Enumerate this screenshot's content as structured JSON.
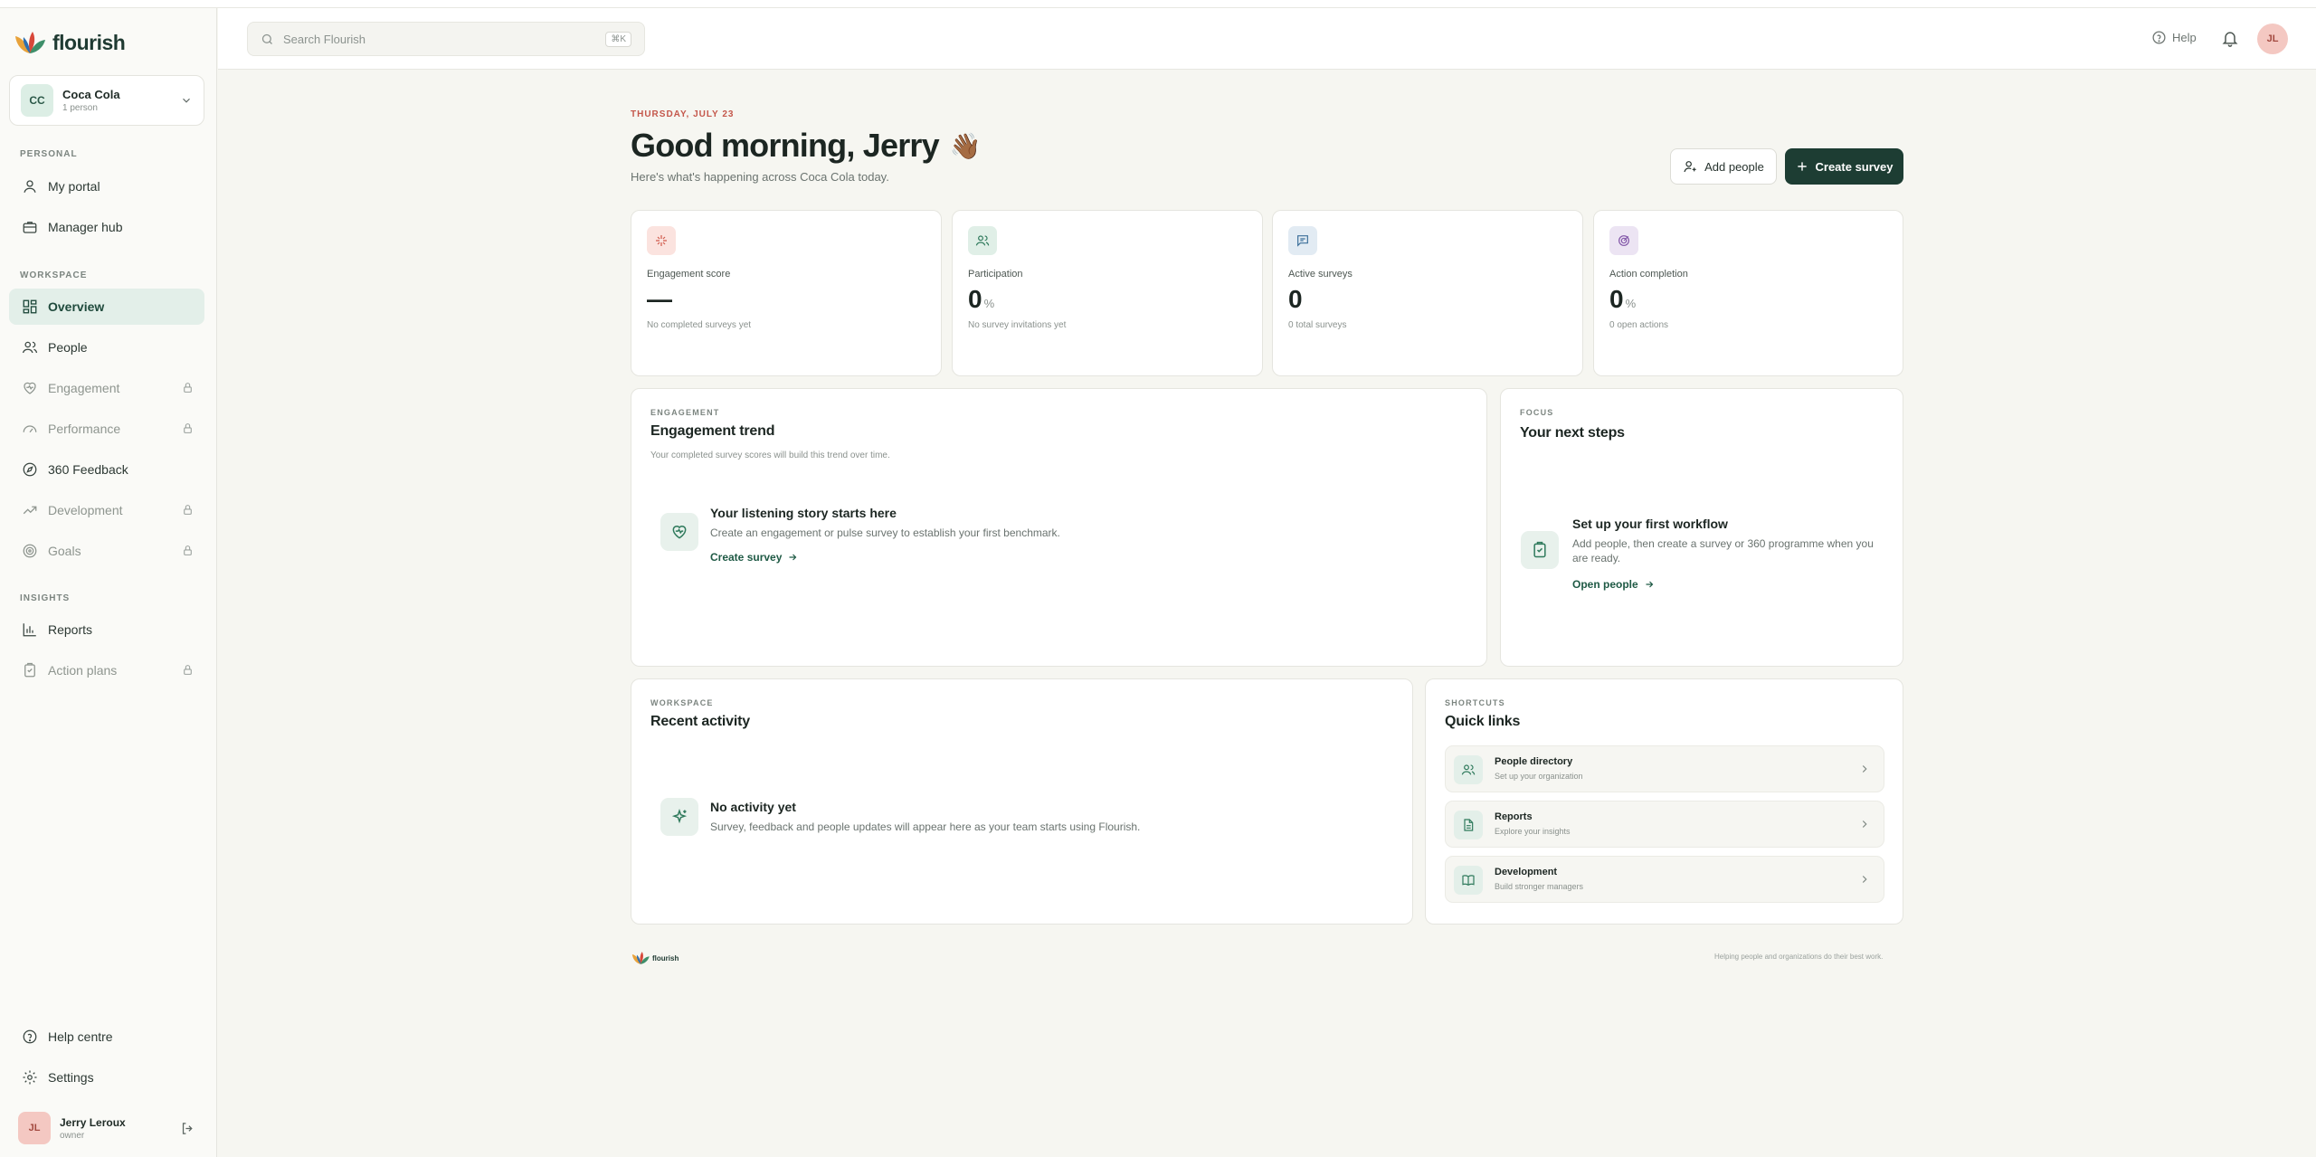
{
  "app": {
    "name": "flourish"
  },
  "org": {
    "initials": "CC",
    "name": "Coca Cola",
    "members": "1 person"
  },
  "sidebar": {
    "personal_label": "PERSONAL",
    "workspace_label": "WORKSPACE",
    "insights_label": "INSIGHTS",
    "personal": [
      {
        "label": "My portal",
        "icon": "user-icon"
      },
      {
        "label": "Manager hub",
        "icon": "briefcase-icon"
      }
    ],
    "workspace": [
      {
        "label": "Overview",
        "icon": "grid-icon",
        "active": true
      },
      {
        "label": "People",
        "icon": "users-icon"
      },
      {
        "label": "Engagement",
        "icon": "heart-icon",
        "locked": true
      },
      {
        "label": "Performance",
        "icon": "gauge-icon",
        "locked": true
      },
      {
        "label": "360 Feedback",
        "icon": "compass-icon"
      },
      {
        "label": "Development",
        "icon": "trend-icon",
        "locked": true
      },
      {
        "label": "Goals",
        "icon": "target-icon",
        "locked": true
      }
    ],
    "insights": [
      {
        "label": "Reports",
        "icon": "bar-chart-icon"
      },
      {
        "label": "Action plans",
        "icon": "clipboard-icon",
        "locked": true
      }
    ],
    "footer": [
      {
        "label": "Help centre",
        "icon": "help-icon"
      },
      {
        "label": "Settings",
        "icon": "gear-icon"
      }
    ]
  },
  "user": {
    "initials": "JL",
    "name": "Jerry Leroux",
    "role": "owner"
  },
  "topbar": {
    "search_placeholder": "Search Flourish",
    "shortcut": "⌘K",
    "help_label": "Help",
    "avatar_initials": "JL"
  },
  "header": {
    "date": "THURSDAY, JULY 23",
    "greeting": "Good morning, Jerry",
    "greeting_emoji": "👋🏾",
    "subtitle": "Here's what's happening across Coca Cola today.",
    "add_people": "Add people",
    "create_survey": "Create survey"
  },
  "stats": [
    {
      "label": "Engagement score",
      "value": "—",
      "unit": "",
      "note": "No completed surveys yet",
      "icon": "sparkle-icon",
      "color": "#fbe3df"
    },
    {
      "label": "Participation",
      "value": "0",
      "unit": "%",
      "note": "No survey invitations yet",
      "icon": "users-icon",
      "color": "#e0efe7"
    },
    {
      "label": "Active surveys",
      "value": "0",
      "unit": "",
      "note": "0 total surveys",
      "icon": "message-icon",
      "color": "#e2ebf3"
    },
    {
      "label": "Action completion",
      "value": "0",
      "unit": "%",
      "note": "0 open actions",
      "icon": "target-icon",
      "color": "#ece4f3"
    }
  ],
  "engagement": {
    "eyebrow": "ENGAGEMENT",
    "title": "Engagement trend",
    "desc": "Your completed survey scores will build this trend over time.",
    "empty_title": "Your listening story starts here",
    "empty_desc": "Create an engagement or pulse survey to establish your first benchmark.",
    "link": "Create survey"
  },
  "focus": {
    "eyebrow": "FOCUS",
    "title": "Your next steps",
    "empty_title": "Set up your first workflow",
    "empty_desc": "Add people, then create a survey or 360 programme when you are ready.",
    "link": "Open people"
  },
  "activity": {
    "eyebrow": "WORKSPACE",
    "title": "Recent activity",
    "empty_title": "No activity yet",
    "empty_desc": "Survey, feedback and people updates will appear here as your team starts using Flourish."
  },
  "shortcuts": {
    "eyebrow": "SHORTCUTS",
    "title": "Quick links",
    "items": [
      {
        "title": "People directory",
        "sub": "Set up your organization",
        "icon": "users-icon"
      },
      {
        "title": "Reports",
        "sub": "Explore your insights",
        "icon": "document-icon"
      },
      {
        "title": "Development",
        "sub": "Build stronger managers",
        "icon": "book-icon"
      }
    ]
  },
  "footer": {
    "brand": "flourish",
    "tagline": "Helping people and organizations do their best work."
  },
  "colors": {
    "accent": "#1d3d33",
    "active_bg": "#e3efe9",
    "date": "#c4574b"
  }
}
